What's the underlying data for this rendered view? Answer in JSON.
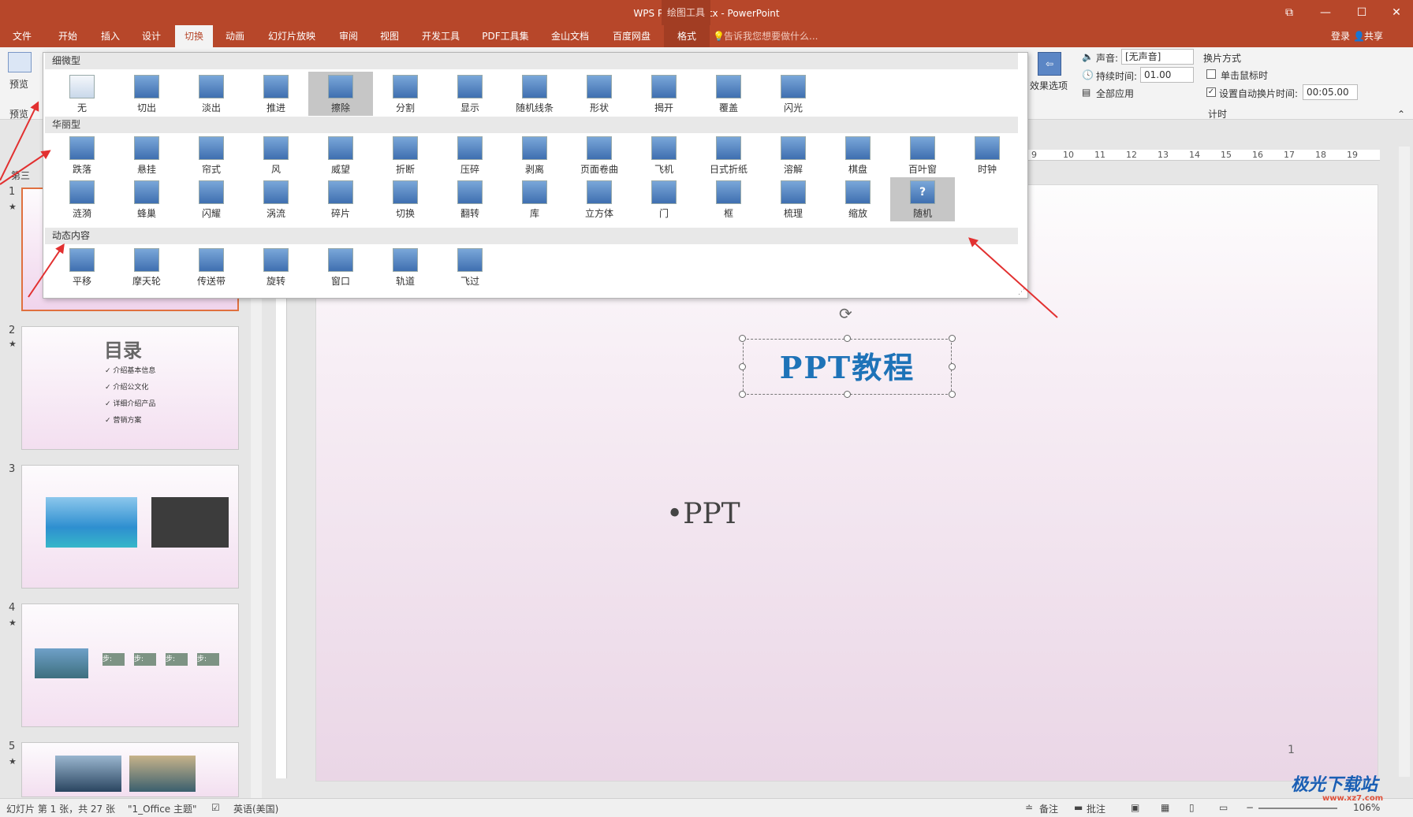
{
  "titlebar": {
    "title": "WPS PPT教程.pptx - PowerPoint",
    "contextual": "绘图工具",
    "btn_restore": "⧉",
    "btn_min": "—",
    "btn_max": "☐",
    "btn_close": "✕"
  },
  "tabs": [
    "文件",
    "开始",
    "插入",
    "设计",
    "切换",
    "动画",
    "幻灯片放映",
    "审阅",
    "视图",
    "开发工具",
    "PDF工具集",
    "金山文档",
    "百度网盘",
    "格式"
  ],
  "active_tab": "切换",
  "tell_me": "告诉我您想要做什么...",
  "login": "登录",
  "share": "共享",
  "ribbon": {
    "preview": "预览",
    "preview_group": "预览",
    "effect_options": "效果选项",
    "sound_label": "声音:",
    "sound_value": "[无声音]",
    "duration_label": "持续时间:",
    "duration_value": "01.00",
    "apply_all": "全部应用",
    "advance_title": "换片方式",
    "on_click": "单击鼠标时",
    "auto_after": "设置自动换片时间:",
    "auto_value": "00:05.00",
    "timing_group": "计时"
  },
  "gallery": {
    "sections": [
      {
        "title": "细微型",
        "items": [
          "无",
          "切出",
          "淡出",
          "推进",
          "擦除",
          "分割",
          "显示",
          "随机线条",
          "形状",
          "揭开",
          "覆盖",
          "闪光"
        ]
      },
      {
        "title": "华丽型",
        "items": [
          "跌落",
          "悬挂",
          "帘式",
          "风",
          "威望",
          "折断",
          "压碎",
          "剥离",
          "页面卷曲",
          "飞机",
          "日式折纸",
          "溶解",
          "棋盘",
          "百叶窗",
          "时钟",
          "涟漪",
          "蜂巢",
          "闪耀",
          "涡流",
          "碎片",
          "切换",
          "翻转",
          "库",
          "立方体",
          "门",
          "框",
          "梳理",
          "缩放",
          "随机"
        ]
      },
      {
        "title": "动态内容",
        "items": [
          "平移",
          "摩天轮",
          "传送带",
          "旋转",
          "窗口",
          "轨道",
          "飞过"
        ]
      }
    ],
    "selected": [
      "擦除",
      "随机"
    ]
  },
  "slides": [
    {
      "num": "1",
      "star": "★"
    },
    {
      "num": "2",
      "star": "★",
      "title": "目录",
      "bullets": [
        "介绍基本信息",
        "介绍公文化",
        "详细介绍产品",
        "营销方案"
      ]
    },
    {
      "num": "3"
    },
    {
      "num": "4",
      "star": "★",
      "steps": [
        "步:",
        "步:",
        "步:",
        "步:"
      ]
    },
    {
      "num": "5",
      "star": "★"
    }
  ],
  "thumb_section": "第三",
  "main_slide": {
    "title": "PPT教程",
    "bullet": "•PPT",
    "page": "1"
  },
  "ruler_ticks": [
    "9",
    "10",
    "11",
    "12",
    "13",
    "14",
    "15",
    "16",
    "17",
    "18",
    "19"
  ],
  "status": {
    "slide_info": "幻灯片 第 1 张，共 27 张",
    "theme": "\"1_Office 主题\"",
    "lang": "英语(美国)",
    "notes": "备注",
    "comments": "批注",
    "zoom": "106%"
  },
  "watermark": {
    "text": "极光下载站",
    "sub": "www.xz7.com"
  },
  "colors": {
    "accent": "#b7472a",
    "title_blue": "#1e73b8",
    "arrow_red": "#e23030"
  }
}
